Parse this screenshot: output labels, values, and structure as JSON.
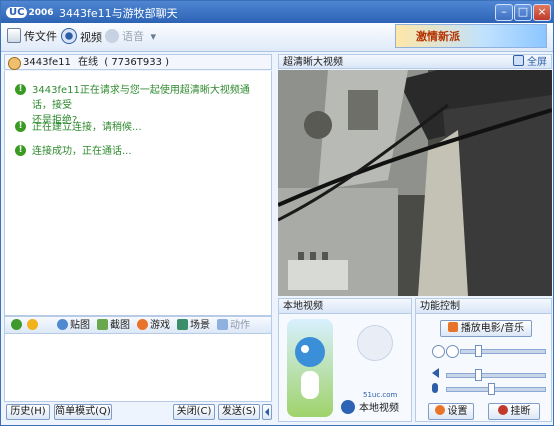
{
  "window": {
    "title": "3443fe11与游牧部聊天",
    "logo_text": "UC",
    "logo_year": "2006",
    "min_glyph": "–",
    "max_glyph": "□",
    "close_glyph": "×"
  },
  "toolbar": {
    "send_file": "传文件",
    "video": "视频",
    "voice": "语音",
    "voice_arrow": "▾",
    "ad_text": "激情新派"
  },
  "contact": {
    "name": "3443fe11",
    "state": "在线",
    "id": "( 7736T933 )"
  },
  "messages": [
    {
      "line1": "3443fe11正在请求与您一起使用超清晰大视频通话，接受",
      "line2": "还是拒绝?"
    },
    {
      "line1": "正在建立连接，请稍候...",
      "line2": ""
    },
    {
      "line1": "连接成功，正在通话...",
      "line2": ""
    }
  ],
  "format_bar": {
    "paste_img": "贴图",
    "screenshot": "截图",
    "games": "游戏",
    "scene": "场景",
    "action": "动作"
  },
  "bottom_bar": {
    "history": "历史(H)",
    "simple_mode": "简单模式(Q)",
    "close": "关闭(C)",
    "send": "发送(S)"
  },
  "video_panel": {
    "header": "超清晰大视频",
    "fullscreen": "全屏"
  },
  "local_panel": {
    "header": "本地视频",
    "brand_small": "51uc.com",
    "brand": "本地视频"
  },
  "control_panel": {
    "header": "功能控制",
    "play_media": "播放电影/音乐",
    "settings": "设置",
    "hangup": "挂断",
    "media_progress": 0.18,
    "volume_level": 0.3,
    "mic_level": 0.45
  }
}
